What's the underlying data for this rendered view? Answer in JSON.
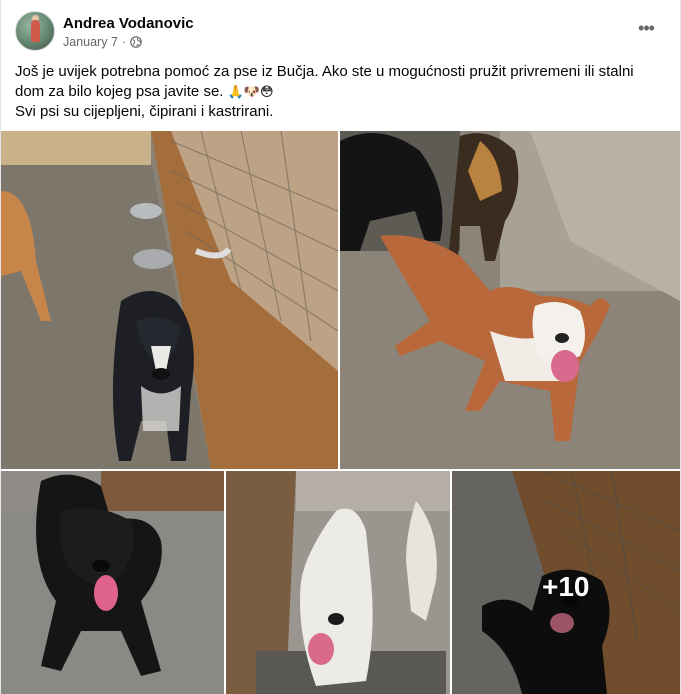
{
  "author": {
    "name": "Andrea Vodanovic",
    "date": "January 7",
    "separator": "·",
    "privacy_icon": "globe-icon"
  },
  "post": {
    "line1": "Još je uvijek potrebna pomoć za pse iz Bučja. Ako ste u mogućnosti pružit privremeni ili stalni",
    "line2": "dom za bilo kojeg psa javite se.",
    "line2_emojis": "🙏🐶😳",
    "line3": "Svi psi su cijepljeni, čipirani i kastrirani."
  },
  "menu": {
    "more_label": "•••"
  },
  "photos": {
    "count": 5,
    "more_overlay": "+10"
  },
  "colors": {
    "text": "#050505",
    "secondary": "#65676b",
    "divider": "#e4e6eb"
  }
}
